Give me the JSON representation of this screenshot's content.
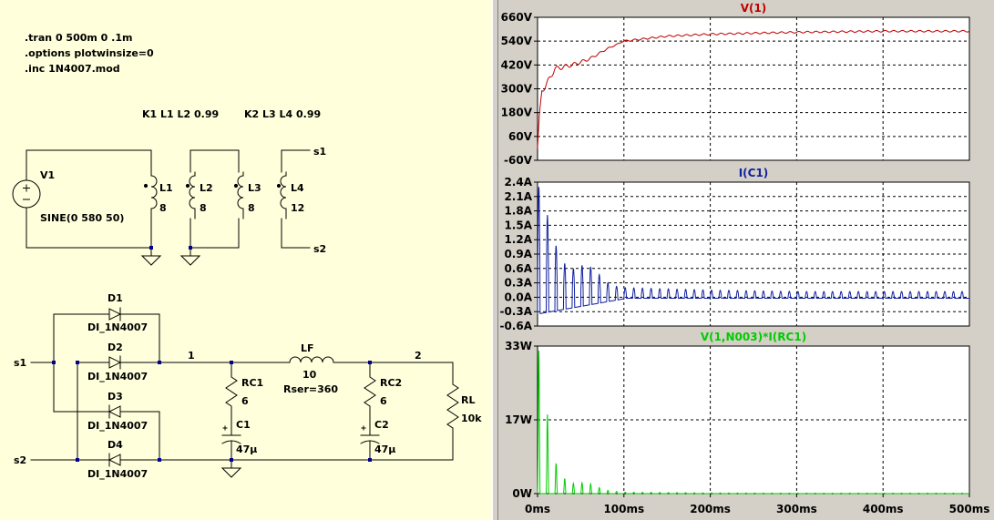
{
  "schematic": {
    "directives": [
      ".tran 0 500m 0 .1m",
      ".options plotwinsize=0",
      ".inc 1N4007.mod"
    ],
    "couplings": [
      "K1 L1 L2 0.99",
      "K2 L3 L4 0.99"
    ],
    "source": {
      "name": "V1",
      "value": "SINE(0 580 50)"
    },
    "inductors": [
      {
        "name": "L1",
        "value": "8"
      },
      {
        "name": "L2",
        "value": "8"
      },
      {
        "name": "L3",
        "value": "8"
      },
      {
        "name": "L4",
        "value": "12"
      }
    ],
    "nets": {
      "s1": "s1",
      "s2": "s2",
      "n1": "1",
      "n2": "2"
    },
    "diodes": [
      {
        "name": "D1",
        "model": "DI_1N4007"
      },
      {
        "name": "D2",
        "model": "DI_1N4007"
      },
      {
        "name": "D3",
        "model": "DI_1N4007"
      },
      {
        "name": "D4",
        "model": "DI_1N4007"
      }
    ],
    "rc1": {
      "name": "RC1",
      "value": "6"
    },
    "c1": {
      "name": "C1",
      "value": "47µ"
    },
    "lf": {
      "name": "LF",
      "value": "10",
      "rser": "Rser=360"
    },
    "rc2": {
      "name": "RC2",
      "value": "6"
    },
    "c2": {
      "name": "C2",
      "value": "47µ"
    },
    "rl": {
      "name": "RL",
      "value": "10k"
    }
  },
  "plots": {
    "x_ticks": [
      "0ms",
      "100ms",
      "200ms",
      "300ms",
      "400ms",
      "500ms"
    ],
    "panes": [
      {
        "title": "V(1)",
        "color": "#c00000",
        "y_ticks": [
          "660V",
          "540V",
          "420V",
          "300V",
          "180V",
          "60V",
          "-60V"
        ]
      },
      {
        "title": "I(C1)",
        "color": "#1020a0",
        "y_ticks": [
          "2.4A",
          "2.1A",
          "1.8A",
          "1.5A",
          "1.2A",
          "0.9A",
          "0.6A",
          "0.3A",
          "0.0A",
          "-0.3A",
          "-0.6A"
        ]
      },
      {
        "title": "V(1,N003)*I(RC1)",
        "color": "#00cc00",
        "y_ticks": [
          "33W",
          "17W",
          "0W"
        ]
      }
    ]
  },
  "chart_data": [
    {
      "type": "line",
      "title": "V(1)",
      "xlabel": "",
      "ylabel": "",
      "xlim": [
        0,
        500
      ],
      "ylim": [
        -60,
        660
      ],
      "x_unit": "ms",
      "y_unit": "V",
      "series": [
        {
          "name": "V(1)",
          "x": [
            0,
            2,
            5,
            10,
            20,
            30,
            40,
            60,
            80,
            100,
            150,
            200,
            300,
            400,
            500
          ],
          "y": [
            0,
            150,
            290,
            320,
            400,
            410,
            420,
            450,
            500,
            540,
            565,
            575,
            585,
            590,
            590
          ]
        }
      ],
      "grid": true
    },
    {
      "type": "line",
      "title": "I(C1)",
      "xlim": [
        0,
        500
      ],
      "ylim": [
        -0.6,
        2.4
      ],
      "x_unit": "ms",
      "y_unit": "A",
      "series": [
        {
          "name": "I(C1)",
          "x": [
            5,
            15,
            25,
            35,
            45,
            55,
            65,
            75,
            85,
            100,
            200,
            300,
            400,
            500
          ],
          "y": [
            2.3,
            1.4,
            0.9,
            0.6,
            0.6,
            0.7,
            0.6,
            0.4,
            0.25,
            0.2,
            0.15,
            0.12,
            0.12,
            0.12
          ]
        }
      ],
      "grid": true
    },
    {
      "type": "line",
      "title": "V(1,N003)*I(RC1)",
      "xlim": [
        0,
        500
      ],
      "ylim": [
        0,
        33
      ],
      "x_unit": "ms",
      "y_unit": "W",
      "series": [
        {
          "name": "V(1,N003)*I(RC1)",
          "x": [
            5,
            15,
            25,
            35,
            45,
            55,
            65,
            75,
            85,
            100,
            200,
            300,
            400,
            500
          ],
          "y": [
            32,
            10,
            5,
            2.5,
            2.2,
            2.5,
            2,
            1,
            0.6,
            0.3,
            0.15,
            0.1,
            0.1,
            0.1
          ]
        }
      ],
      "grid": true
    }
  ]
}
